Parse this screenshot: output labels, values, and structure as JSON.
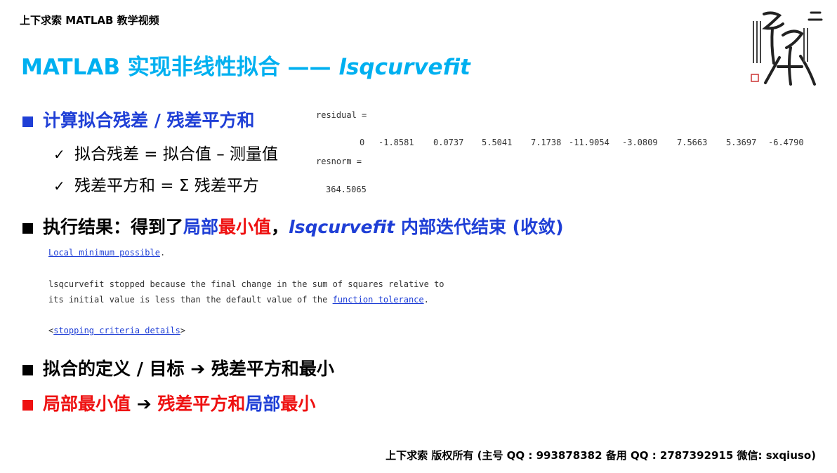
{
  "header": {
    "channel": "上下求索 MATLAB 教学视频"
  },
  "title": {
    "main": "MATLAB 实现非线性拟合 —— ",
    "func": "lsqcurvefit"
  },
  "colors": {
    "title": "#00b0f0",
    "blue": "#1f3fd6",
    "red": "#ee1111",
    "black": "#000000"
  },
  "bullet1": {
    "label": "计算拟合残差 / 残差平方和",
    "sub1": "拟合残差 = 拟合值 – 测量值",
    "sub2": "残差平方和 = Σ 残差平方",
    "check_icon": "✓"
  },
  "output1": {
    "residual_label": "residual =",
    "residual_values": [
      "0",
      "-1.8581",
      "0.0737",
      "5.5041",
      "7.1738",
      "-11.9054",
      "-3.0809",
      "7.5663",
      "5.3697",
      "-6.4790"
    ],
    "resnorm_label": "resnorm =",
    "resnorm_value": "364.5065"
  },
  "bullet2": {
    "prefix": "执行结果：得到了",
    "blue1": "局部",
    "red1": "最小值",
    "comma": "，",
    "func": "lsqcurvefit",
    "blue2": " 内部迭代结束 (收敛)"
  },
  "output2": {
    "line1_link": "Local minimum possible",
    "line1_end": ".",
    "line2": "lsqcurvefit stopped because the final change in the sum of squares relative to",
    "line3_pre": "its initial value is less than the default value of the ",
    "line3_link": "function tolerance",
    "line3_end": ".",
    "line4_open": "<",
    "line4_link": "stopping criteria details",
    "line4_close": ">"
  },
  "bullet3": {
    "text1": "拟合的定义 / 目标 ",
    "arrow": "➔",
    "text2": " 残差平方和最小"
  },
  "bullet4": {
    "text1": "局部最小值 ",
    "arrow": "➔",
    "red2": " 残差平方和",
    "blue": "局部",
    "red3": "最小"
  },
  "footer": {
    "text": "上下求索  版权所有  (主号 QQ : 993878382   备用 QQ : 2787392915   微信: sxqiuso)"
  },
  "logo": {
    "name": "seal-calligraphy"
  }
}
